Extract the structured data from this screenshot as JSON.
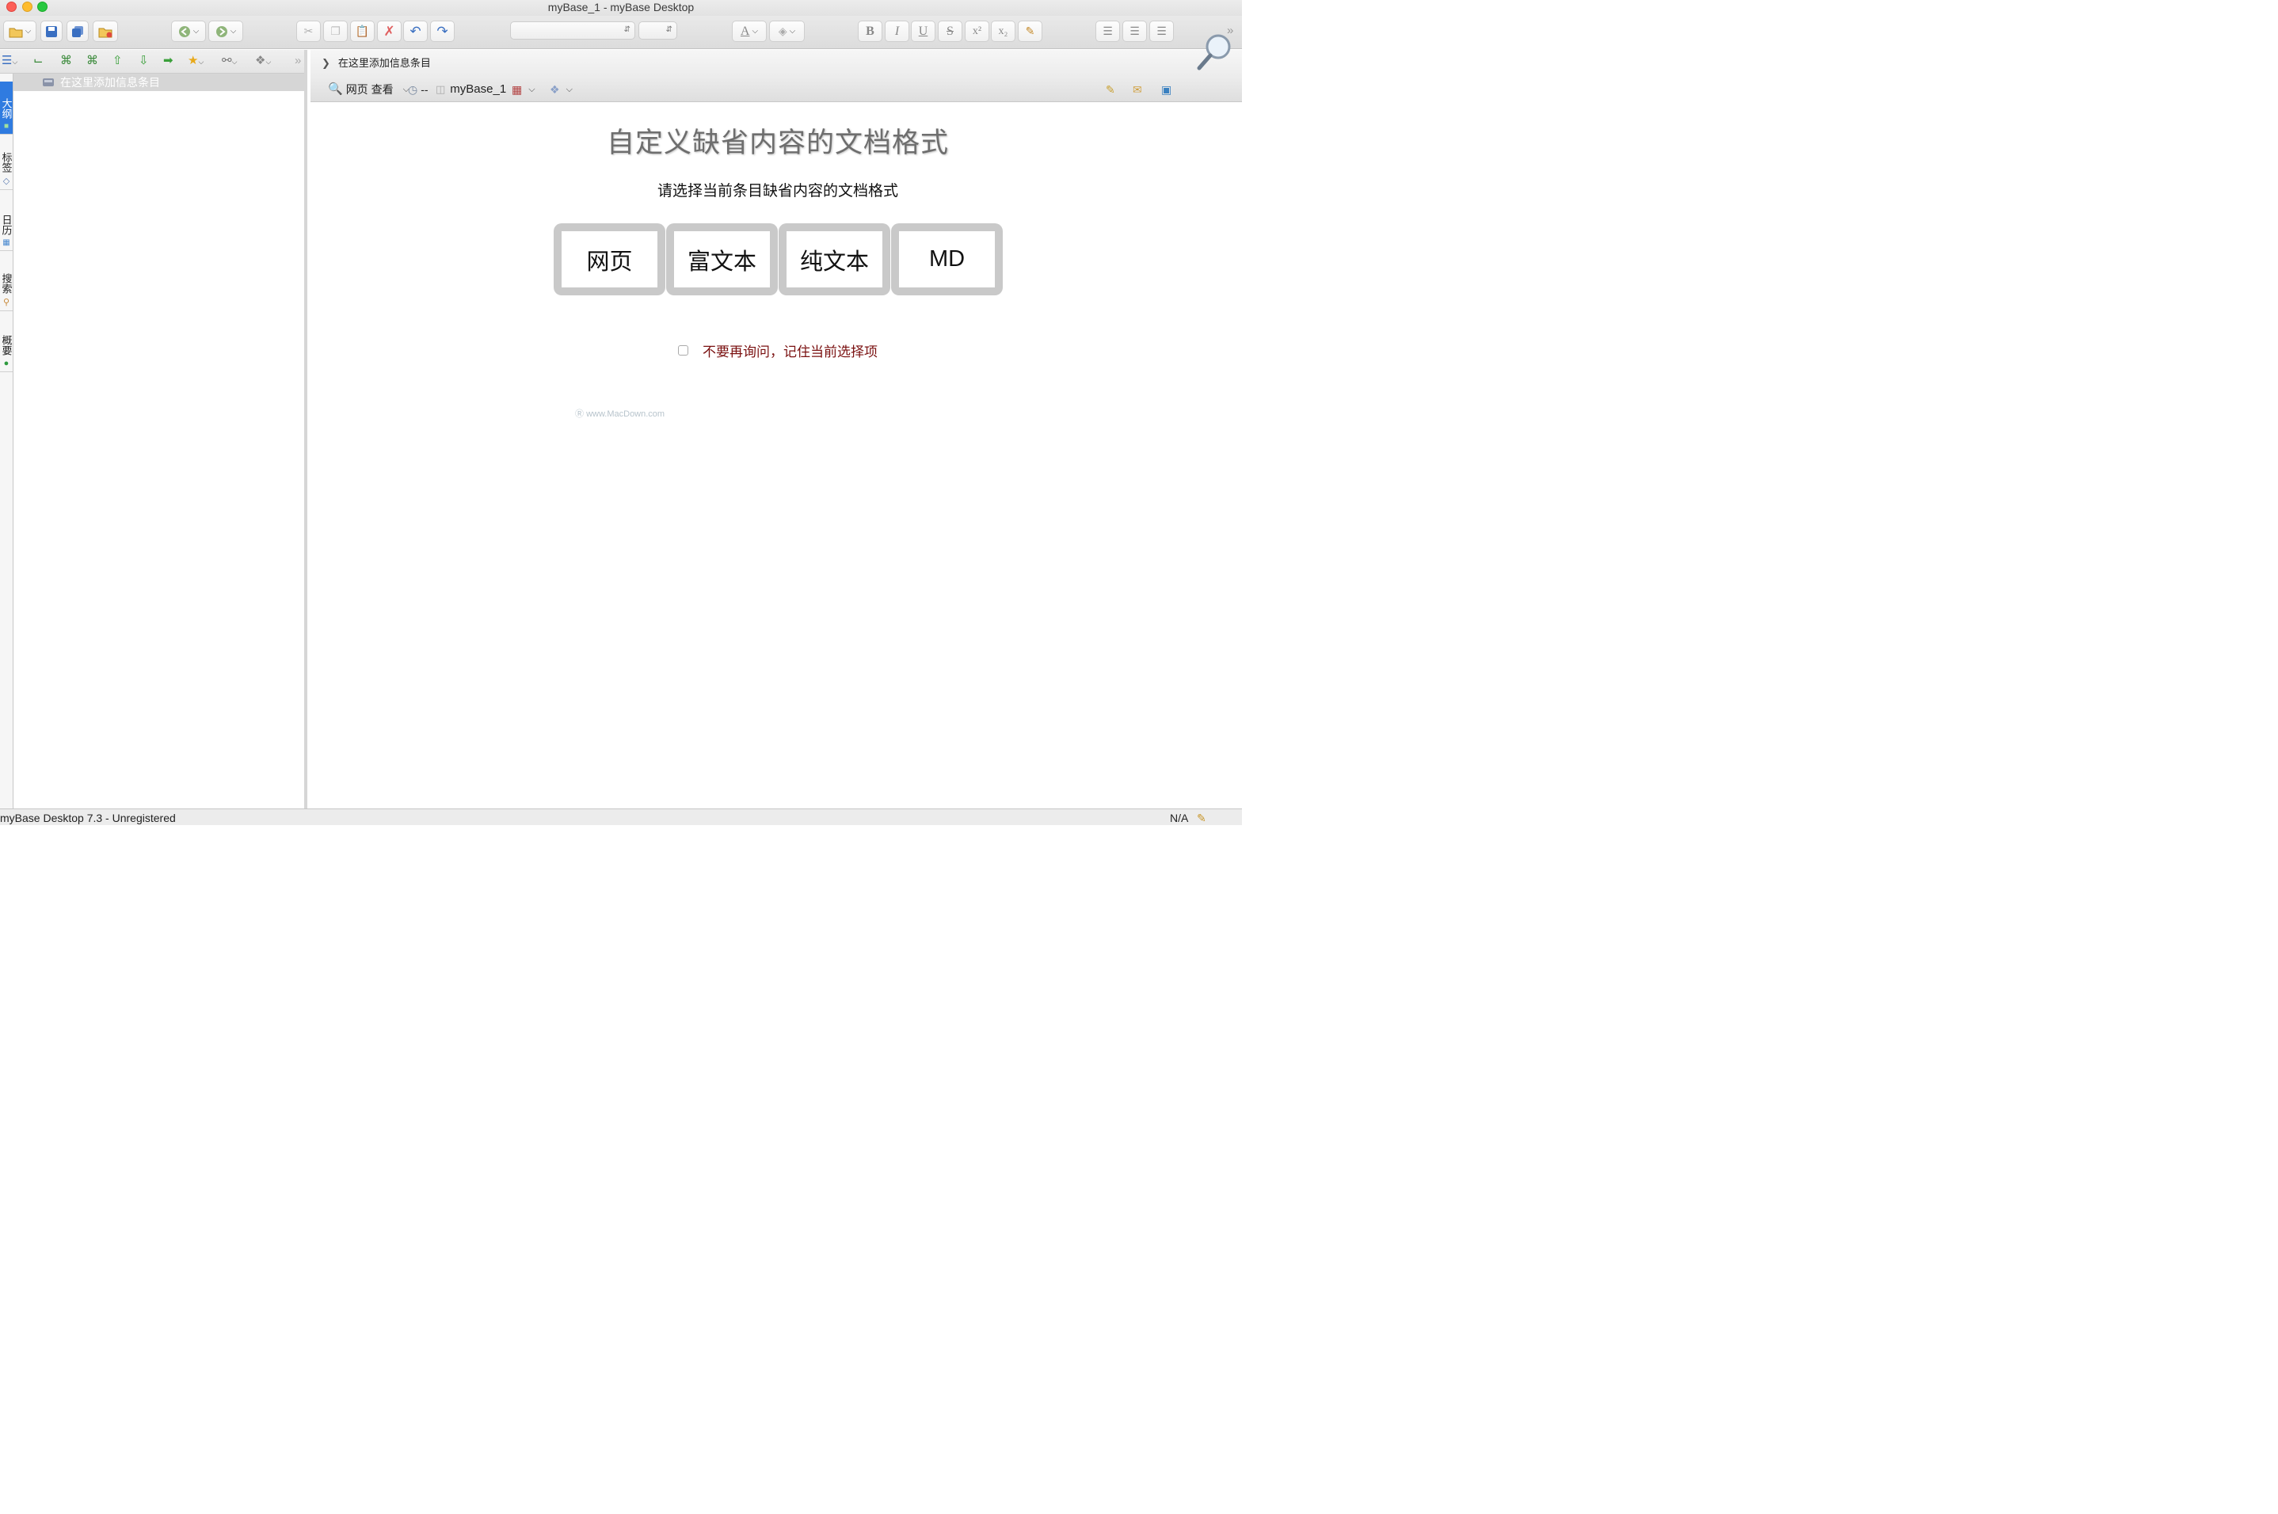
{
  "window": {
    "title": "myBase_1 - myBase Desktop"
  },
  "toolbar": {
    "font_name_value": "",
    "font_size_value": "",
    "bold": "B",
    "italic": "I",
    "underline": "U",
    "strike": "S",
    "superscript": "x²",
    "subscript": "x₂",
    "text_color_glyph": "A"
  },
  "sidebar": {
    "tabs": [
      {
        "label": "大纲",
        "active": true
      },
      {
        "label": "标签",
        "active": false
      },
      {
        "label": "日历",
        "active": false
      },
      {
        "label": "搜索",
        "active": false
      },
      {
        "label": "概要",
        "active": false
      }
    ],
    "tree": {
      "items": [
        {
          "label": "在这里添加信息条目"
        }
      ]
    }
  },
  "editor": {
    "breadcrumb": "在这里添加信息条目",
    "view_mode": "网页 查看",
    "time_text": "--",
    "db_name": "myBase_1"
  },
  "dialog": {
    "title": "自定义缺省内容的文档格式",
    "subtitle": "请选择当前条目缺省内容的文档格式",
    "options": [
      "网页",
      "富文本",
      "纯文本",
      "MD"
    ],
    "remember_label": "不要再询问，记住当前选择项",
    "remember_checked": false
  },
  "watermark": "www.MacDown.com",
  "status": {
    "left": "myBase Desktop 7.3 - Unregistered",
    "right": "N/A"
  },
  "colors": {
    "accent_tab": "#2f7be0",
    "option_border": "#c9c9c9",
    "remember_text": "#7a1010",
    "tree_selected": "#d6d6d6"
  }
}
